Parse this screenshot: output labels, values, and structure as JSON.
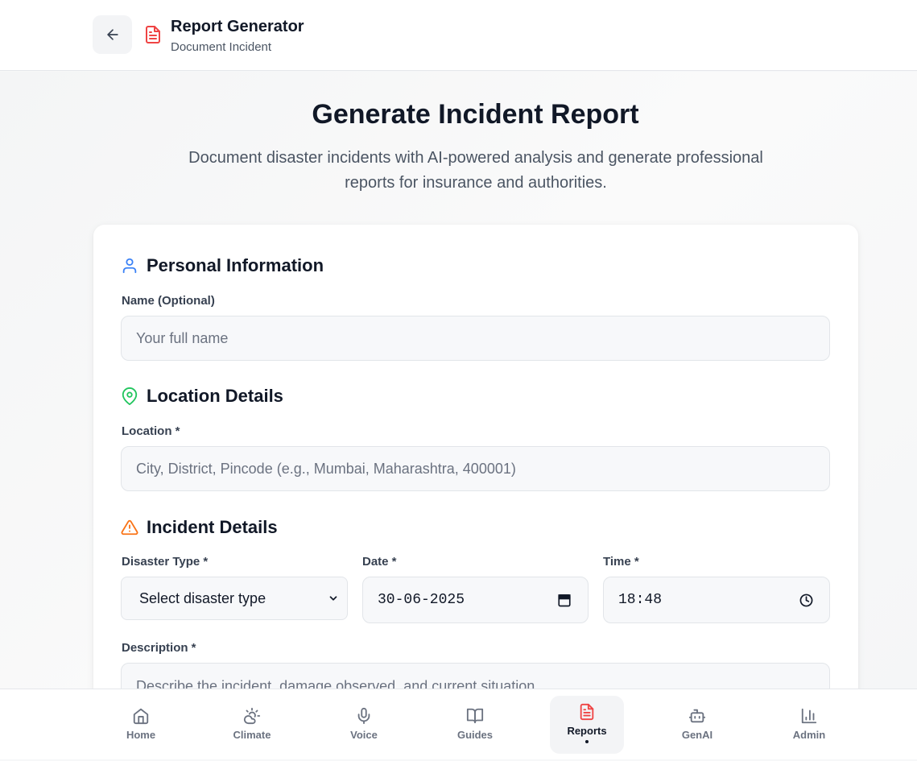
{
  "header": {
    "title": "Report Generator",
    "subtitle": "Document Incident",
    "back_icon": "arrow-left-icon",
    "page_icon": "file-text-icon"
  },
  "hero": {
    "title": "Generate Incident Report",
    "subtitle": "Document disaster incidents with AI-powered analysis and generate professional reports for insurance and authorities."
  },
  "form": {
    "personal": {
      "title": "Personal Information",
      "icon": "user-icon",
      "name_label": "Name (Optional)",
      "name_placeholder": "Your full name"
    },
    "location": {
      "title": "Location Details",
      "icon": "map-pin-icon",
      "location_label": "Location *",
      "location_placeholder": "City, District, Pincode (e.g., Mumbai, Maharashtra, 400001)"
    },
    "incident": {
      "title": "Incident Details",
      "icon": "alert-triangle-icon",
      "disaster_type_label": "Disaster Type *",
      "disaster_type_value": "Select disaster type",
      "date_label": "Date *",
      "date_value": "30-06-2025",
      "time_label": "Time *",
      "time_value": "18:48",
      "description_label": "Description *",
      "description_placeholder": "Describe the incident, damage observed, and current situation..."
    }
  },
  "colors": {
    "accent_red": "#ef4444",
    "user_blue": "#3b82f6",
    "location_green": "#22c55e",
    "warning_orange": "#f97316"
  },
  "nav": {
    "items": [
      {
        "label": "Home",
        "icon": "home-icon"
      },
      {
        "label": "Climate",
        "icon": "cloud-sun-icon"
      },
      {
        "label": "Voice",
        "icon": "microphone-icon"
      },
      {
        "label": "Guides",
        "icon": "book-open-icon"
      },
      {
        "label": "Reports",
        "icon": "file-text-icon",
        "active": true
      },
      {
        "label": "GenAI",
        "icon": "bot-icon"
      },
      {
        "label": "Admin",
        "icon": "bar-chart-icon"
      }
    ]
  }
}
